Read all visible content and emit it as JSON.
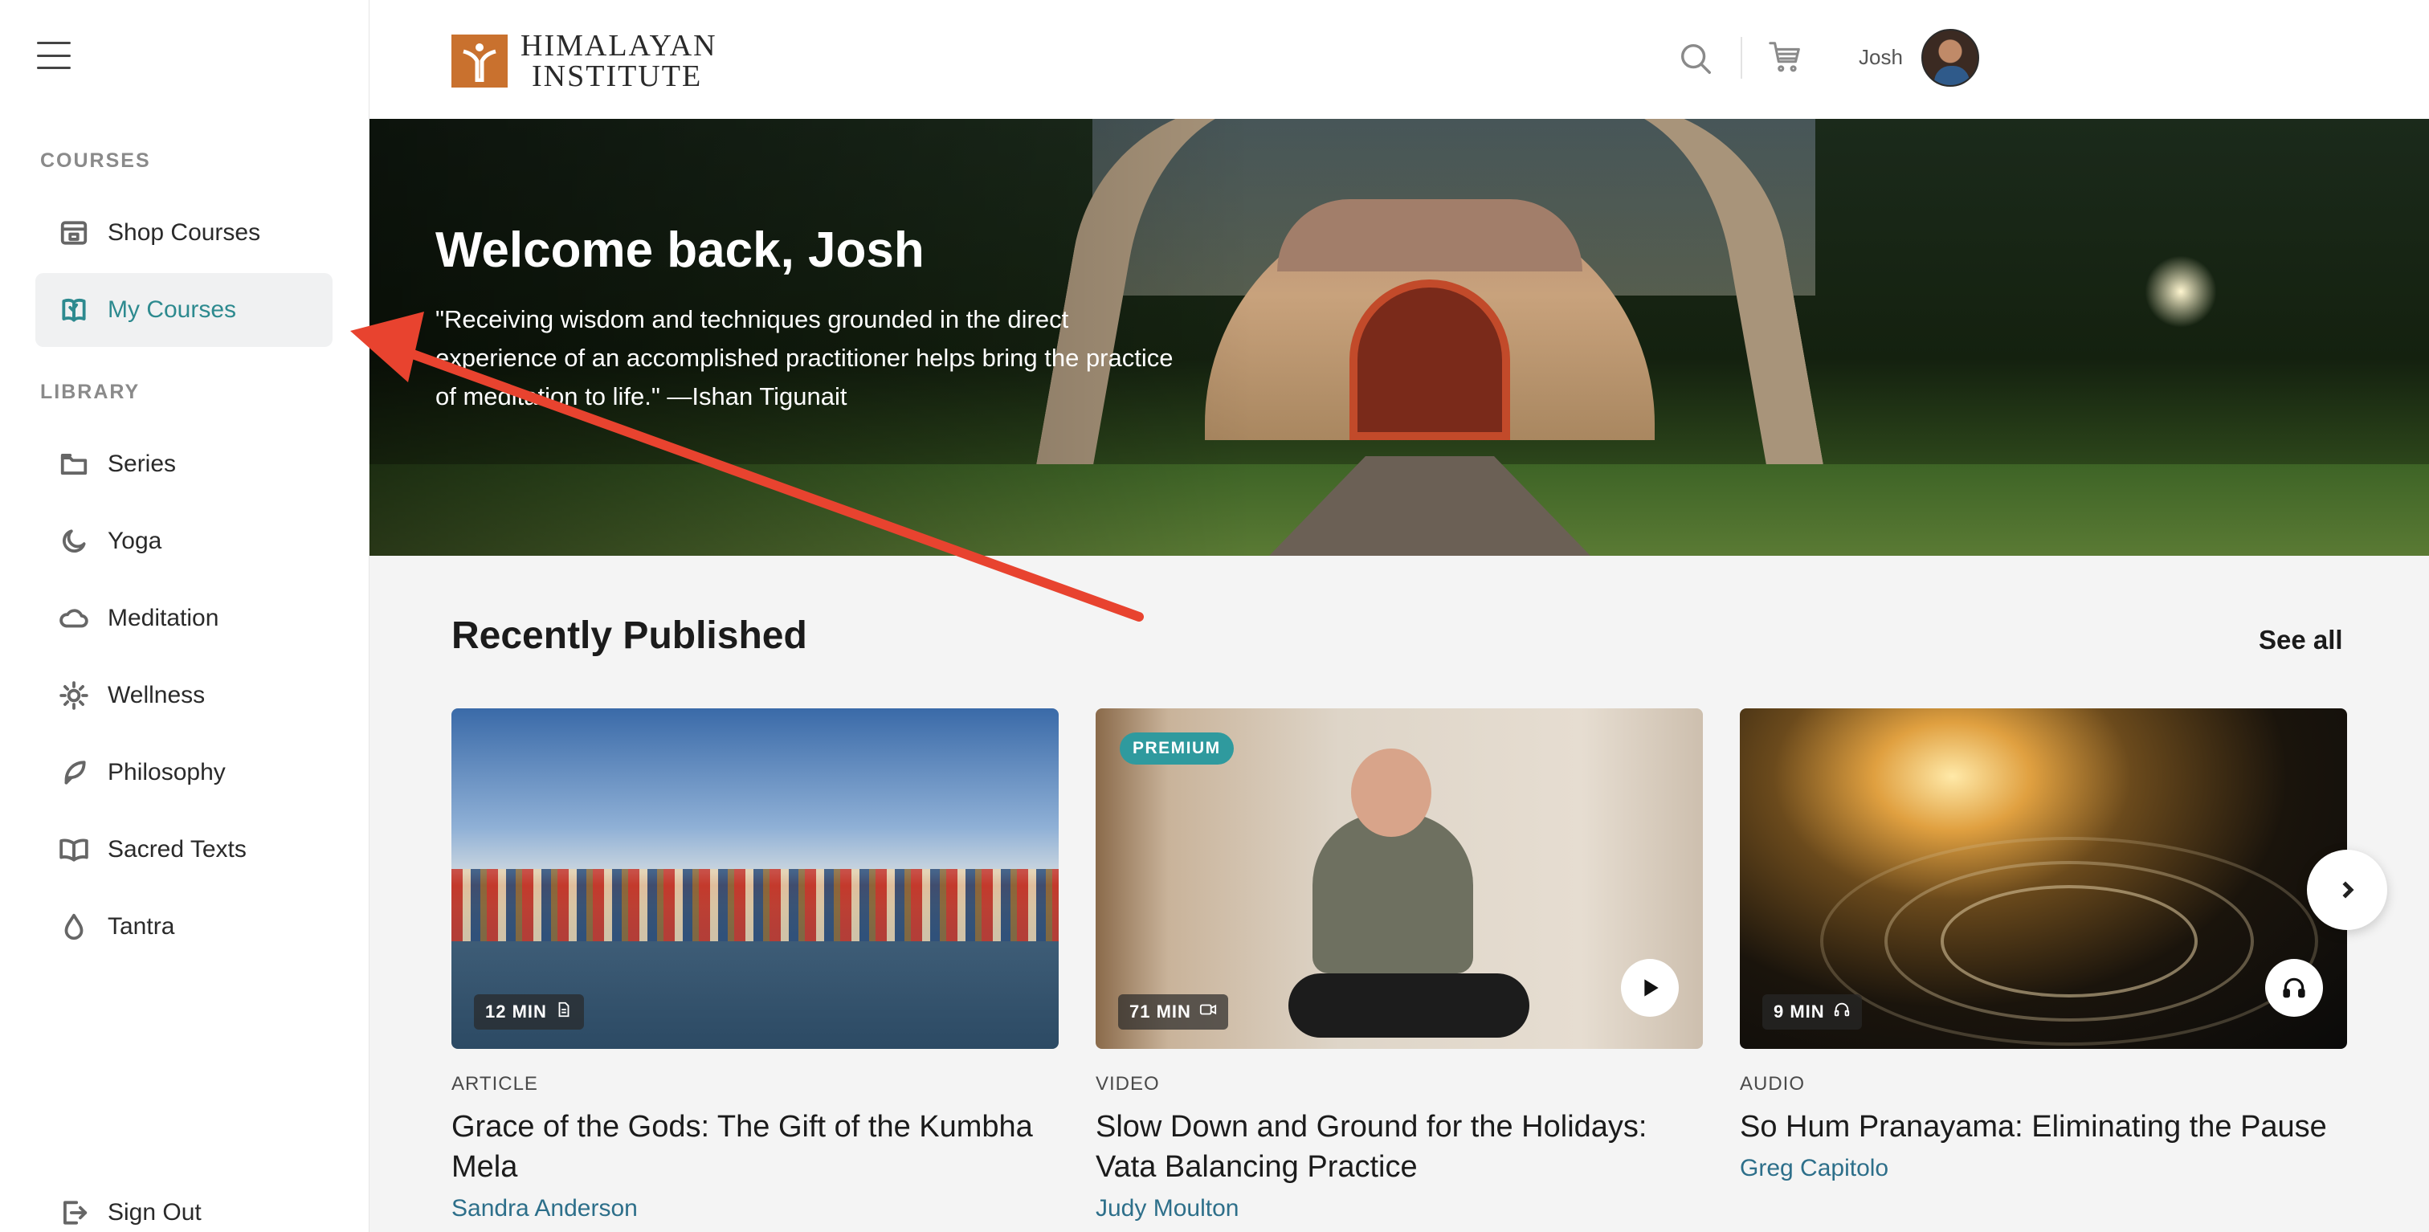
{
  "brand": {
    "line1": "HIMALAYAN",
    "line2": "INSTITUTE",
    "mark_color": "#c9712e"
  },
  "sidebar": {
    "sections": [
      {
        "label": "COURSES"
      },
      {
        "label": "LIBRARY"
      }
    ],
    "items": [
      {
        "label": "Shop Courses",
        "icon": "shop-icon"
      },
      {
        "label": "My Courses",
        "icon": "book-mark-icon",
        "active": true
      },
      {
        "label": "Series",
        "icon": "folder-icon"
      },
      {
        "label": "Yoga",
        "icon": "moon-icon"
      },
      {
        "label": "Meditation",
        "icon": "cloud-icon"
      },
      {
        "label": "Wellness",
        "icon": "sun-icon"
      },
      {
        "label": "Philosophy",
        "icon": "feather-icon"
      },
      {
        "label": "Sacred Texts",
        "icon": "open-book-icon"
      },
      {
        "label": "Tantra",
        "icon": "drop-icon"
      }
    ],
    "sign_out": "Sign Out",
    "active_color": "#2d8a8f"
  },
  "header": {
    "user_name": "Josh",
    "icons": [
      "search-icon",
      "cart-icon"
    ]
  },
  "hero": {
    "title": "Welcome back, Josh",
    "quote": "\"Receiving wisdom and techniques grounded in the direct experience of an accomplished practitioner helps bring the practice of meditation to life.\" —Ishan Tigunait"
  },
  "recent": {
    "title": "Recently Published",
    "see_all": "See all",
    "cards": [
      {
        "type": "ARTICLE",
        "duration": "12 MIN",
        "media_icon": "document-icon",
        "title": "Grace of the Gods: The Gift of the Kumbha Mela",
        "author": "Sandra Anderson"
      },
      {
        "type": "VIDEO",
        "duration": "71 MIN",
        "media_icon": "video-icon",
        "badge": "PREMIUM",
        "title": "Slow Down and Ground for the Holidays: Vata Balancing Practice",
        "author": "Judy Moulton"
      },
      {
        "type": "AUDIO",
        "duration": "9 MIN",
        "media_icon": "headphones-icon",
        "title": "So Hum Pranayama: Eliminating the Pause",
        "author": "Greg Capitolo"
      }
    ]
  },
  "colors": {
    "accent_teal": "#2d8a8f",
    "author_link": "#2d6f8a",
    "premium_badge": "#2f9a9e",
    "annotation_arrow": "#e8432f"
  }
}
